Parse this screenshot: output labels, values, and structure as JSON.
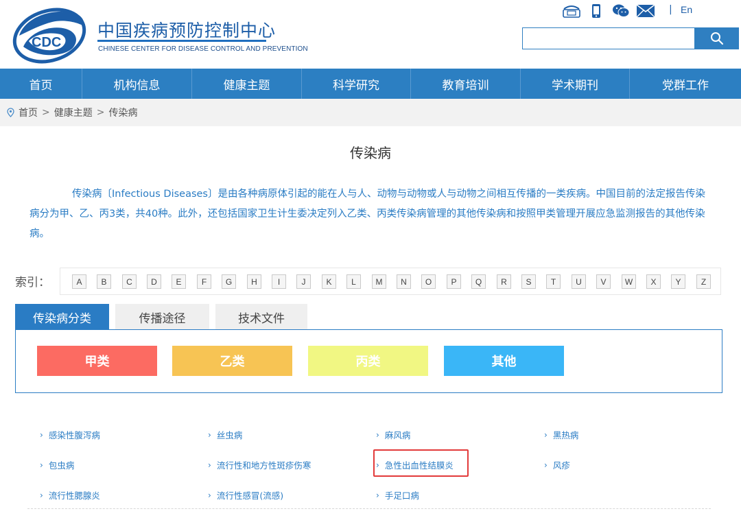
{
  "header": {
    "logo_text": "CDC",
    "title_cn": "中国疾病预防控制中心",
    "title_en": "CHINESE CENTER FOR DISEASE CONTROL AND PREVENTION",
    "lang_separator": "|",
    "lang": "En",
    "icons": [
      "phone-icon",
      "mobile-icon",
      "wechat-icon",
      "mail-icon"
    ],
    "search": {
      "value": "",
      "placeholder": ""
    }
  },
  "nav": {
    "items": [
      "首页",
      "机构信息",
      "健康主题",
      "科学研究",
      "教育培训",
      "学术期刊",
      "党群工作"
    ]
  },
  "breadcrumb": {
    "items": [
      "首页",
      "健康主题",
      "传染病"
    ],
    "separator": ">"
  },
  "main": {
    "title": "传染病",
    "intro": "传染病〔Infectious Diseases〕是由各种病原体引起的能在人与人、动物与动物或人与动物之间相互传播的一类疾病。中国目前的法定报告传染病分为甲、乙、丙3类，共40种。此外，还包括国家卫生计生委决定列入乙类、丙类传染病管理的其他传染病和按照甲类管理开展应急监测报告的其他传染病。",
    "index_label": "索引：",
    "letters": [
      "A",
      "B",
      "C",
      "D",
      "E",
      "F",
      "G",
      "H",
      "I",
      "J",
      "K",
      "L",
      "M",
      "N",
      "O",
      "P",
      "Q",
      "R",
      "S",
      "T",
      "U",
      "V",
      "W",
      "X",
      "Y",
      "Z"
    ],
    "tabs": [
      "传染病分类",
      "传播途径",
      "技术文件"
    ],
    "classes": [
      {
        "label": "甲类",
        "color": "#fc6b62"
      },
      {
        "label": "乙类",
        "color": "#f7c454"
      },
      {
        "label": "丙类",
        "color": "#f1f783"
      },
      {
        "label": "其他",
        "color": "#3ab6f7"
      }
    ],
    "diseases": [
      [
        "感染性腹泻病",
        "丝虫病",
        "麻风病",
        "黑热病"
      ],
      [
        "包虫病",
        "流行性和地方性斑疹伤寒",
        "急性出血性结膜炎",
        "风疹"
      ],
      [
        "流行性腮腺炎",
        "流行性感冒(流感)",
        "手足口病"
      ]
    ]
  },
  "colors": {
    "brand_blue": "#2c7fc2",
    "link_blue": "#2a7cc4",
    "highlight_red": "#e23a3a"
  }
}
